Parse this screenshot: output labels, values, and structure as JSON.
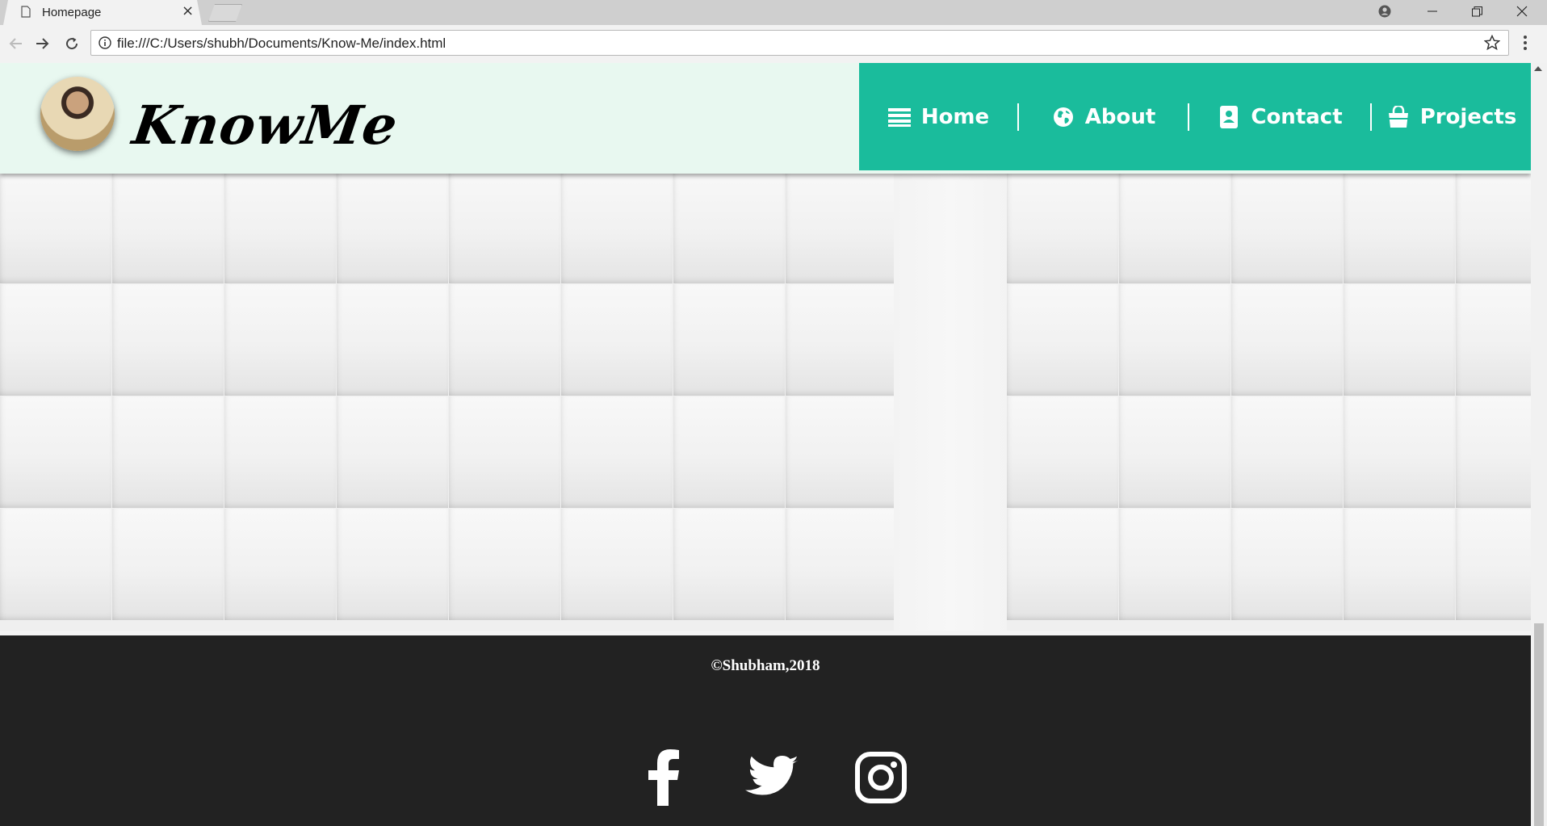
{
  "browser": {
    "tab_title": "Homepage",
    "tab_close": "×",
    "url": "file:///C:/Users/shubh/Documents/Know-Me/index.html"
  },
  "site": {
    "brand": "KnowMe",
    "nav": [
      {
        "label": "Home",
        "icon": "menu-lines-icon"
      },
      {
        "label": "About",
        "icon": "globe-icon"
      },
      {
        "label": "Contact",
        "icon": "contact-card-icon"
      },
      {
        "label": "Projects",
        "icon": "shopping-bag-icon"
      }
    ],
    "footer": {
      "copyright": "©Shubham,2018",
      "social": [
        "facebook-icon",
        "twitter-icon",
        "instagram-icon"
      ]
    }
  },
  "colors": {
    "header_bg": "#e8f8f0",
    "nav_bg": "#1abc9c",
    "footer_bg": "#222222"
  }
}
